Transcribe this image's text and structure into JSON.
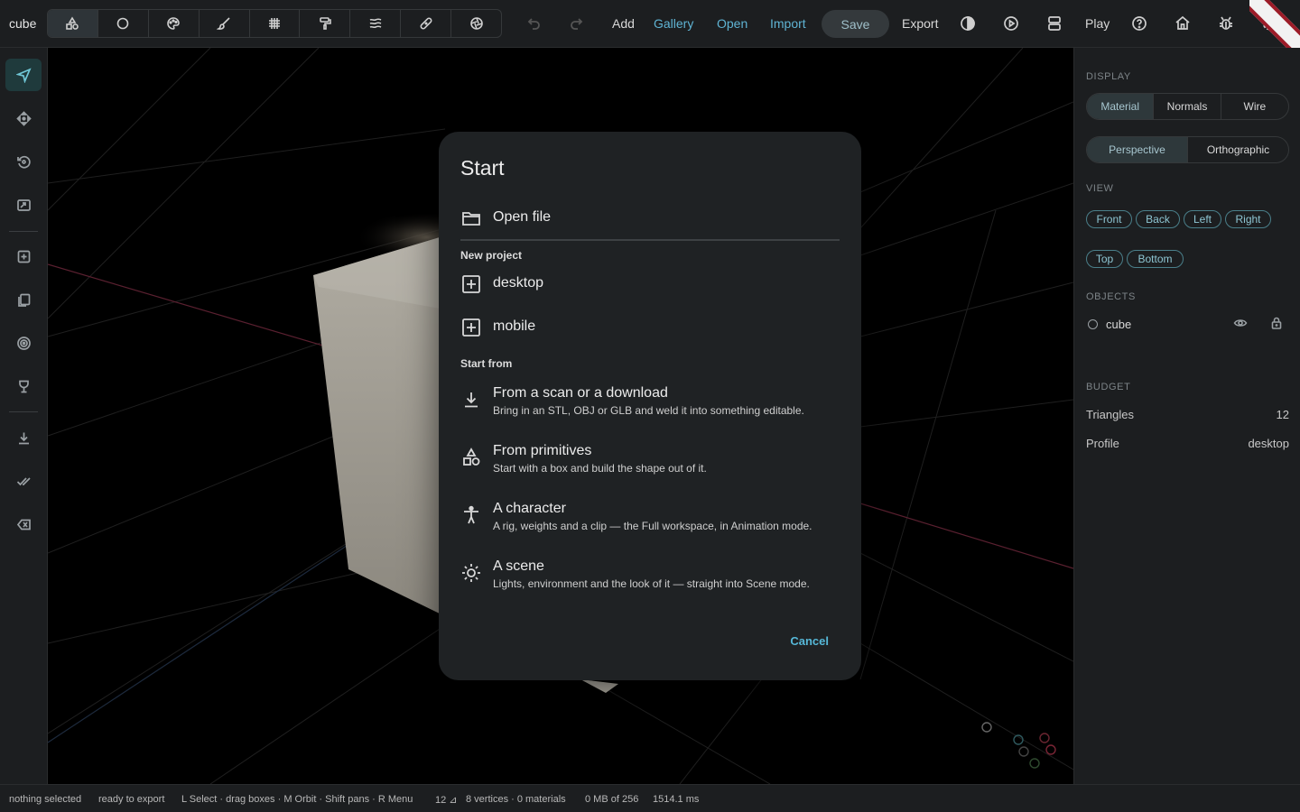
{
  "app": {
    "title": "cube"
  },
  "toolbar": {
    "tools": [
      {
        "name": "shapes-icon"
      },
      {
        "name": "circle-icon"
      },
      {
        "name": "palette-icon"
      },
      {
        "name": "brush-icon"
      },
      {
        "name": "grid-icon"
      },
      {
        "name": "paint-roller-icon"
      },
      {
        "name": "layers-icon"
      },
      {
        "name": "bandage-icon"
      },
      {
        "name": "aperture-icon"
      }
    ],
    "add": "Add",
    "gallery": "Gallery",
    "open": "Open",
    "import": "Import",
    "save": "Save",
    "export": "Export",
    "play": "Play",
    "accent_color": "#5fb4d4"
  },
  "right_panel": {
    "display_label": "DISPLAY",
    "shading": [
      "Material",
      "Normals",
      "Wire"
    ],
    "shading_selected": "Material",
    "projection": [
      "Perspective",
      "Orthographic"
    ],
    "projection_selected": "Perspective",
    "view_label": "VIEW",
    "views_row1": [
      "Front",
      "Back",
      "Left",
      "Right"
    ],
    "views_row2": [
      "Top",
      "Bottom"
    ],
    "objects_label": "OBJECTS",
    "objects": [
      {
        "name": "cube"
      }
    ],
    "budget_label": "BUDGET",
    "triangles_label": "Triangles",
    "triangles_value": "12",
    "profile_label": "Profile",
    "profile_value": "desktop"
  },
  "status": {
    "selection": "nothing selected",
    "export_state": "ready to export",
    "hints": "L Select · drag boxes · M Orbit · Shift pans · R Menu",
    "tri_count": "12 ⊿",
    "geometry": "8 vertices · 0 materials",
    "memory": "0 MB of 256",
    "timing": "1514.1 ms"
  },
  "dialog": {
    "title": "Start",
    "open_file": "Open file",
    "new_project_label": "New project",
    "new_projects": [
      "desktop",
      "mobile"
    ],
    "start_from_label": "Start from",
    "templates": [
      {
        "title": "From a scan or a download",
        "desc": "Bring in an STL, OBJ or GLB and weld it into something editable."
      },
      {
        "title": "From primitives",
        "desc": "Start with a box and build the shape out of it."
      },
      {
        "title": "A character",
        "desc": "A rig, weights and a clip — the Full workspace, in Animation mode."
      },
      {
        "title": "A scene",
        "desc": "Lights, environment and the look of it — straight into Scene mode."
      }
    ],
    "cancel": "Cancel"
  }
}
